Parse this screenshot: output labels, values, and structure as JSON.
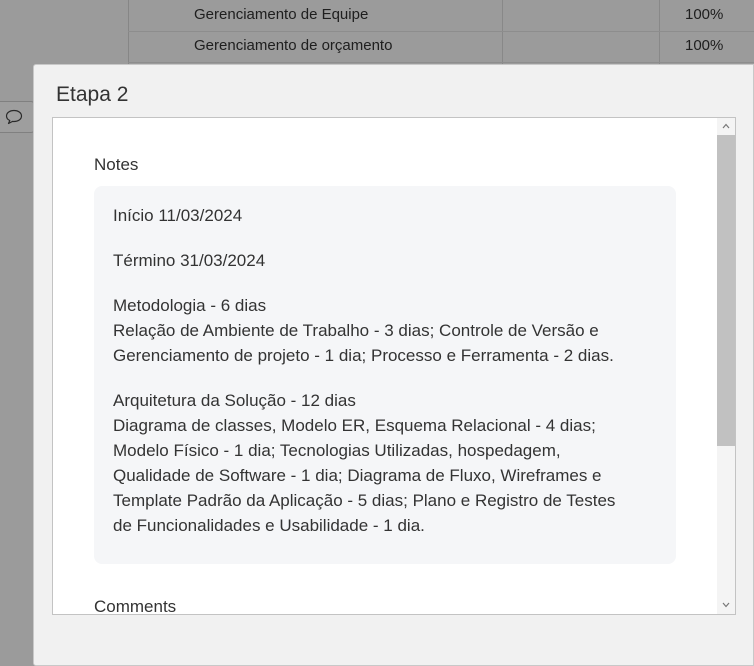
{
  "background": {
    "rows": [
      {
        "task": "Gerenciamento de Equipe",
        "percent": "100%"
      },
      {
        "task": "Gerenciamento de orçamento",
        "percent": "100%"
      }
    ],
    "comment_toggle_icon": "comment-icon"
  },
  "modal": {
    "title": "Etapa 2",
    "notes_heading": "Notes",
    "notes": [
      {
        "lines": [
          "Início 11/03/2024"
        ]
      },
      {
        "lines": [
          "Término 31/03/2024"
        ]
      },
      {
        "lines": [
          "Metodologia - 6 dias",
          "Relação de Ambiente de Trabalho - 3 dias; Controle de Versão e",
          "Gerenciamento de projeto - 1 dia; Processo e Ferramenta - 2 dias."
        ]
      },
      {
        "lines": [
          "Arquitetura da Solução - 12 dias",
          "Diagrama de classes, Modelo ER, Esquema Relacional - 4 dias;",
          "Modelo Físico - 1 dia; Tecnologias Utilizadas, hospedagem,",
          "Qualidade de Software - 1 dia; Diagrama de Fluxo, Wireframes e",
          "Template Padrão da Aplicação - 5 dias; Plano e Registro de Testes",
          "de Funcionalidades e Usabilidade - 1 dia."
        ]
      }
    ],
    "comments_heading": "Comments"
  },
  "colors": {
    "overlay": "#000000",
    "notes_background": "#f5f6f8",
    "text": "#333333",
    "scroll_thumb": "#c1c1c1"
  }
}
